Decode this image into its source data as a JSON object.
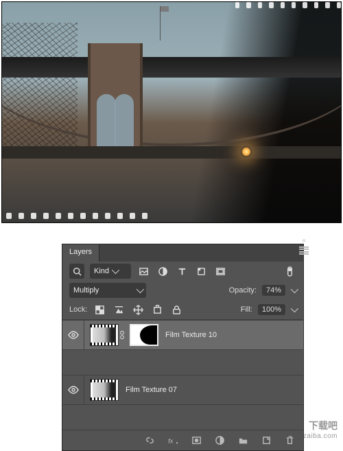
{
  "canvas": {
    "alt": "Brooklyn Bridge with film texture overlay"
  },
  "panel": {
    "title": "Layers",
    "filter": {
      "kind_label": "Kind",
      "icons": [
        "image-filter-icon",
        "adjustment-filter-icon",
        "type-filter-icon",
        "shape-filter-icon",
        "smartobject-filter-icon"
      ]
    },
    "blend_mode": "Multiply",
    "opacity": {
      "label": "Opacity:",
      "value": "74%"
    },
    "lock": {
      "label": "Lock:",
      "icons": [
        "lock-transparency-icon",
        "lock-image-icon",
        "lock-position-icon",
        "lock-artboard-icon",
        "lock-all-icon"
      ]
    },
    "fill": {
      "label": "Fill:",
      "value": "100%"
    },
    "layers": [
      {
        "name": "Film Texture 10",
        "has_mask": true,
        "visible": true,
        "selected": true
      },
      {
        "name": "Film Texture 07",
        "has_mask": false,
        "visible": true,
        "selected": false
      }
    ],
    "footer_icons": [
      "link-layers-icon",
      "fx-icon",
      "mask-icon",
      "adjustment-layer-icon",
      "group-icon",
      "new-layer-icon",
      "trash-icon"
    ]
  },
  "watermark": {
    "line1": "下载吧",
    "line2": "www.xiazaiba.com"
  }
}
